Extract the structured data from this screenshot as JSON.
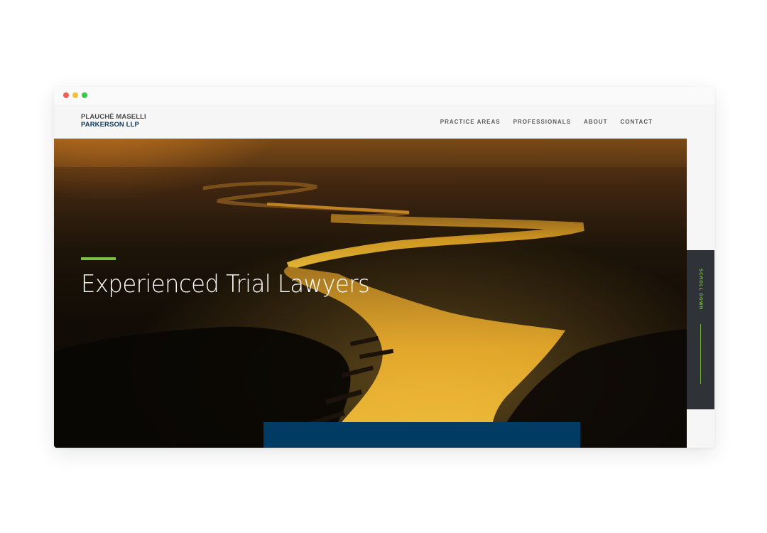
{
  "logo": {
    "line1": "PLAUCHÉ MASELLI",
    "line2": "PARKERSON LLP"
  },
  "nav": {
    "items": [
      {
        "label": "PRACTICE AREAS"
      },
      {
        "label": "PROFESSIONALS"
      },
      {
        "label": "ABOUT"
      },
      {
        "label": "CONTACT"
      }
    ]
  },
  "hero": {
    "title": "Experienced Trial Lawyers",
    "image": "aerial-river-sunset"
  },
  "scroll": {
    "label": "SCROLL DOWN"
  },
  "colors": {
    "accent_green": "#7cc242",
    "navy": "#003b63",
    "logo_navy": "#0f3a5c",
    "scroll_panel": "#2f3337",
    "header_bg": "#f6f6f6"
  }
}
